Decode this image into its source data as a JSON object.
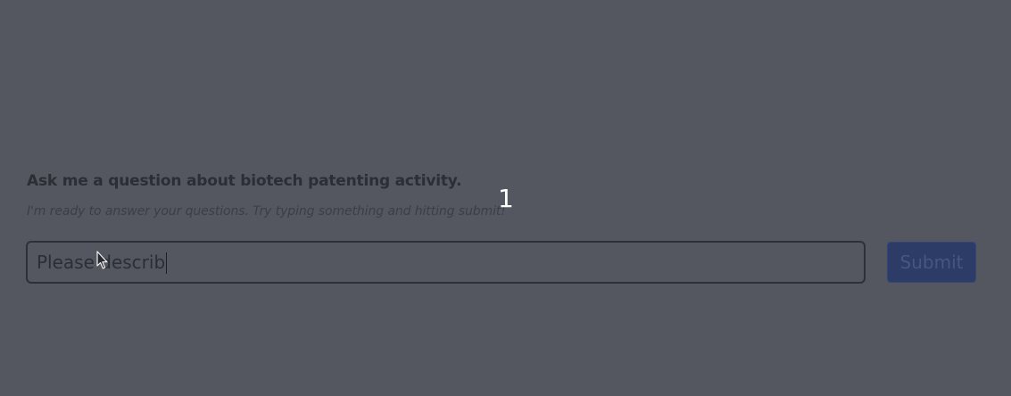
{
  "prompt": {
    "heading": "Ask me a question about biotech patenting activity.",
    "subtext": "I'm ready to answer your questions. Try typing something and hitting submit!"
  },
  "overlay": {
    "step_number": "1"
  },
  "query_input": {
    "value": "Please describ"
  },
  "submit": {
    "label": "Submit"
  },
  "colors": {
    "background": "#545660",
    "text": "#2c2e36",
    "button_bg": "#2c3c66",
    "button_text": "#47557f"
  },
  "icons": {
    "cursor": "mouse-pointer-icon"
  }
}
